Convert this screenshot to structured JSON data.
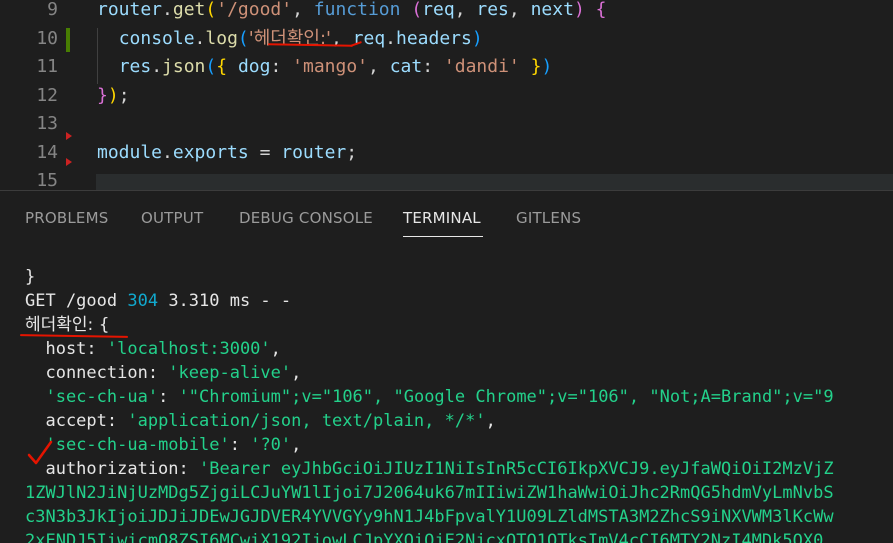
{
  "editor": {
    "lines": [
      {
        "num": "9",
        "tokens": [
          [
            "var",
            "router"
          ],
          [
            "punc",
            "."
          ],
          [
            "fn",
            "get"
          ],
          [
            "brk",
            "("
          ],
          [
            "str",
            "'/good'"
          ],
          [
            "punc",
            ", "
          ],
          [
            "kw",
            "function"
          ],
          [
            "punc",
            " "
          ],
          [
            "brk2",
            "("
          ],
          [
            "var",
            "req"
          ],
          [
            "punc",
            ", "
          ],
          [
            "var",
            "res"
          ],
          [
            "punc",
            ", "
          ],
          [
            "var",
            "next"
          ],
          [
            "brk2",
            ")"
          ],
          [
            "punc",
            " "
          ],
          [
            "brk2",
            "{"
          ]
        ]
      },
      {
        "num": "10",
        "tokens": [
          [
            "punc",
            "  "
          ],
          [
            "var",
            "console"
          ],
          [
            "punc",
            "."
          ],
          [
            "fn",
            "log"
          ],
          [
            "brk3",
            "("
          ],
          [
            "str",
            "'헤더확인:'"
          ],
          [
            "punc",
            ", "
          ],
          [
            "var",
            "req"
          ],
          [
            "punc",
            "."
          ],
          [
            "var",
            "headers"
          ],
          [
            "brk3",
            ")"
          ]
        ]
      },
      {
        "num": "11",
        "tokens": [
          [
            "punc",
            "  "
          ],
          [
            "var",
            "res"
          ],
          [
            "punc",
            "."
          ],
          [
            "fn",
            "json"
          ],
          [
            "brk3",
            "("
          ],
          [
            "brk",
            "{"
          ],
          [
            "punc",
            " "
          ],
          [
            "var",
            "dog"
          ],
          [
            "punc",
            ": "
          ],
          [
            "str",
            "'mango'"
          ],
          [
            "punc",
            ", "
          ],
          [
            "var",
            "cat"
          ],
          [
            "punc",
            ": "
          ],
          [
            "str",
            "'dandi'"
          ],
          [
            "punc",
            " "
          ],
          [
            "brk",
            "}"
          ],
          [
            "brk3",
            ")"
          ]
        ]
      },
      {
        "num": "12",
        "tokens": [
          [
            "brk2",
            "}"
          ],
          [
            "brk",
            ")"
          ],
          [
            "punc",
            ";"
          ]
        ]
      },
      {
        "num": "13",
        "tokens": []
      },
      {
        "num": "14",
        "tokens": [
          [
            "var",
            "module"
          ],
          [
            "punc",
            "."
          ],
          [
            "var",
            "exports"
          ],
          [
            "punc",
            " = "
          ],
          [
            "var",
            "router"
          ],
          [
            "punc",
            ";"
          ]
        ]
      },
      {
        "num": "15",
        "tokens": []
      }
    ]
  },
  "panel": {
    "tabs": [
      "PROBLEMS",
      "OUTPUT",
      "DEBUG CONSOLE",
      "TERMINAL",
      "GITLENS"
    ],
    "active_tab": "TERMINAL"
  },
  "terminal": {
    "lines": [
      [
        [
          "t-white",
          "}"
        ]
      ],
      [
        [
          "t-white",
          "GET /good "
        ],
        [
          "t-cyan",
          "304"
        ],
        [
          "t-white",
          " 3.310 ms - -"
        ]
      ],
      [
        [
          "t-white",
          "헤더확인: {"
        ]
      ],
      [
        [
          "t-white",
          "  host: "
        ],
        [
          "t-green",
          "'localhost:3000'"
        ],
        [
          "t-white",
          ","
        ]
      ],
      [
        [
          "t-white",
          "  connection: "
        ],
        [
          "t-green",
          "'keep-alive'"
        ],
        [
          "t-white",
          ","
        ]
      ],
      [
        [
          "t-white",
          "  "
        ],
        [
          "t-green",
          "'sec-ch-ua'"
        ],
        [
          "t-white",
          ": "
        ],
        [
          "t-green",
          "'\"Chromium\";v=\"106\", \"Google Chrome\";v=\"106\", \"Not;A=Brand\";v=\"9"
        ]
      ],
      [
        [
          "t-white",
          "  accept: "
        ],
        [
          "t-green",
          "'application/json, text/plain, */*'"
        ],
        [
          "t-white",
          ","
        ]
      ],
      [
        [
          "t-white",
          "  "
        ],
        [
          "t-green",
          "'sec-ch-ua-mobile'"
        ],
        [
          "t-white",
          ": "
        ],
        [
          "t-green",
          "'?0'"
        ],
        [
          "t-white",
          ","
        ]
      ],
      [
        [
          "t-white",
          "  authorization: "
        ],
        [
          "t-green",
          "'Bearer eyJhbGciOiJIUzI1NiIsInR5cCI6IkpXVCJ9.eyJfaWQiOiI2MzVjZ"
        ]
      ],
      [
        [
          "t-green",
          "1ZWJlN2JiNjUzMDg5ZjgiLCJuYW1lIjoi7J2064uk67mIIiwiZW1haWwiOiJhc2RmQG5hdmVyLmNvbS"
        ]
      ],
      [
        [
          "t-green",
          "c3N3b3JkIjoiJDJiJDEwJGJDVER4YVVGYy9hN1J4bFpvalY1U09LZldMSTA3M2ZhcS9iNXVWM3lKcWw"
        ]
      ],
      [
        [
          "t-green",
          "2xENDJ5IiwicmQ8ZSI6MCwiX192IjowLCJpYXQiOjE2NjcxOTQ1OTksImV4cCI6MTY2NzI4MDk5OX0"
        ]
      ]
    ]
  }
}
